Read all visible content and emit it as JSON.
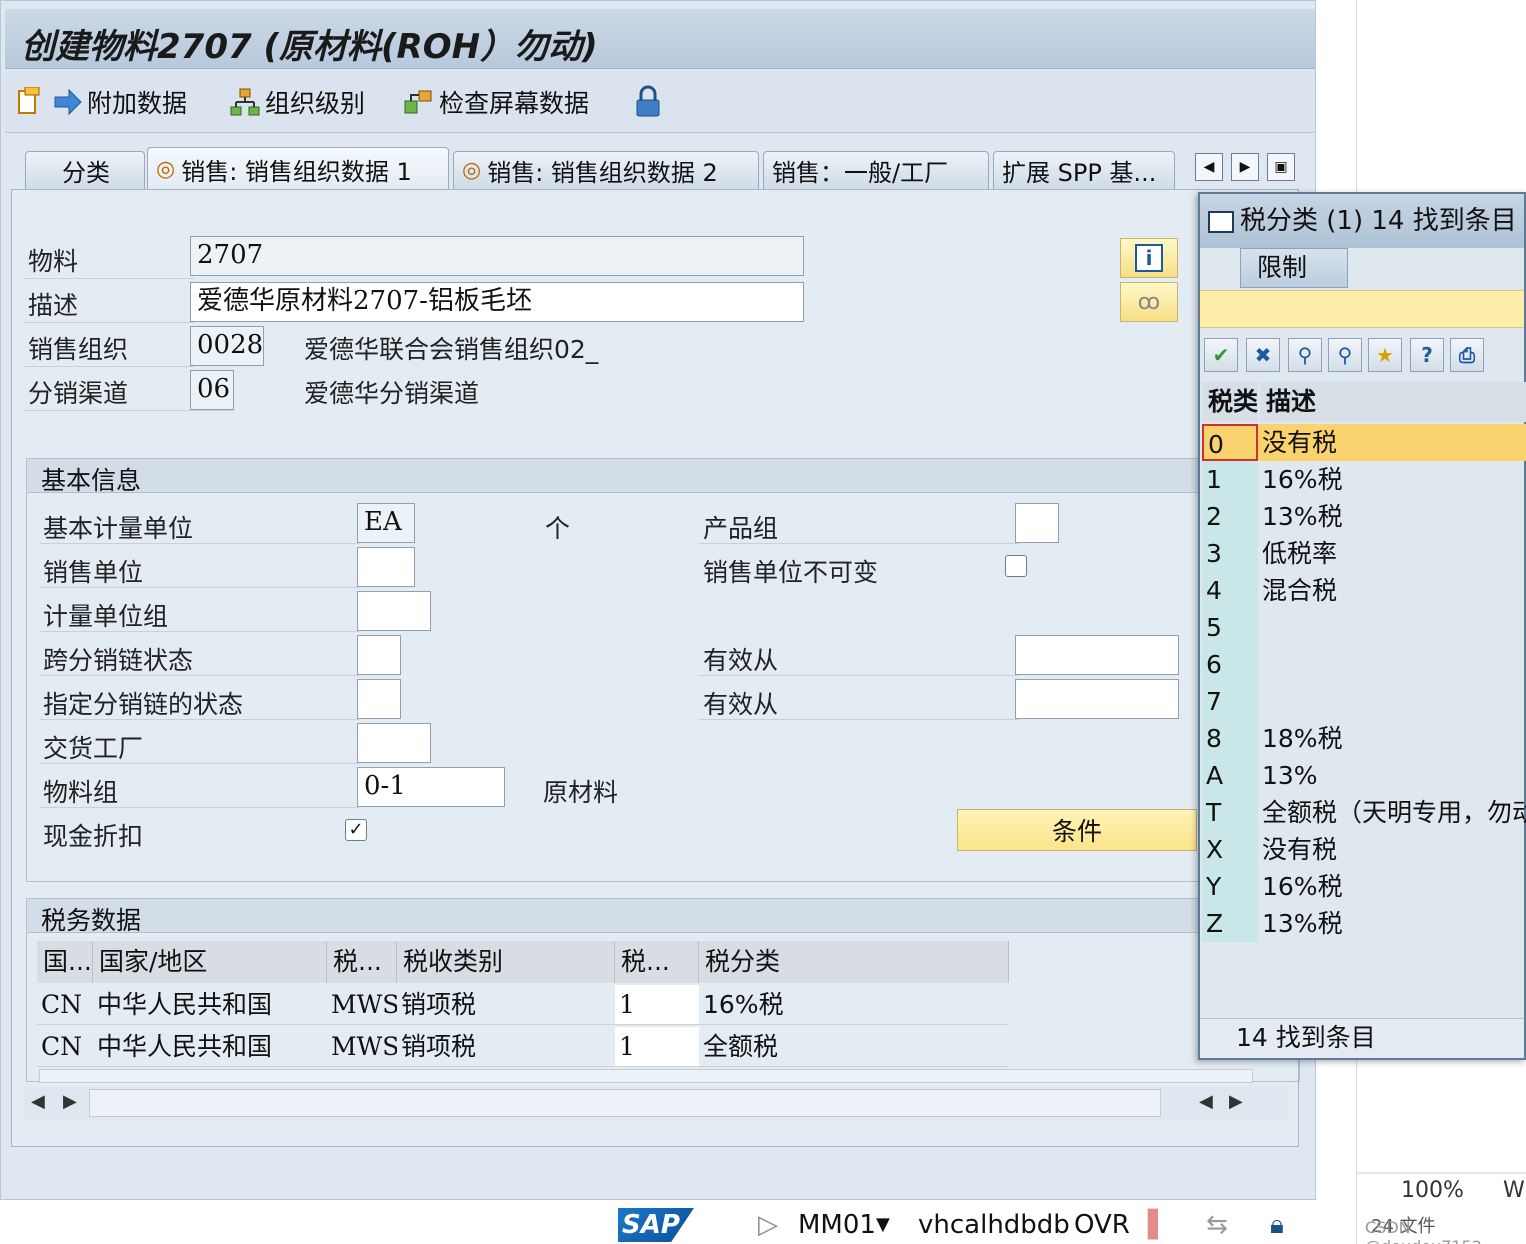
{
  "window": {
    "title": "创建物料2707 (原材料(ROH）勿动)"
  },
  "toolbar": {
    "additional_data": "附加数据",
    "org_levels": "组织级别",
    "check_screen": "检查屏幕数据"
  },
  "tabs": [
    {
      "label": "分类"
    },
    {
      "label": "销售: 销售组织数据 1"
    },
    {
      "label": "销售: 销售组织数据 2"
    },
    {
      "label": "销售：一般/工厂"
    },
    {
      "label": "扩展 SPP 基..."
    }
  ],
  "header": {
    "material_label": "物料",
    "material_value": "2707",
    "desc_label": "描述",
    "desc_value": "爱德华原材料2707-铝板毛坯",
    "salesorg_label": "销售组织",
    "salesorg_value": "0028",
    "salesorg_text": "爱德华联合会销售组织02_",
    "channel_label": "分销渠道",
    "channel_value": "06",
    "channel_text": "爱德华分销渠道"
  },
  "basic": {
    "title": "基本信息",
    "base_uom_label": "基本计量单位",
    "base_uom_value": "EA",
    "base_uom_text": "个",
    "sales_unit_label": "销售单位",
    "uom_group_label": "计量单位组",
    "xdchain_label": "跨分销链状态",
    "dchain_label": "指定分销链的状态",
    "plant_label": "交货工厂",
    "matgroup_label": "物料组",
    "matgroup_value": "0-1",
    "matgroup_text": "原材料",
    "cash_discount_label": "现金折扣",
    "prodgroup_label": "产品组",
    "sales_unit_fixed_label": "销售单位不可变",
    "valid_from_label": "有效从",
    "valid_from2_label": "有效从",
    "conditions_button": "条件"
  },
  "tax": {
    "title": "税务数据",
    "columns": [
      "国...",
      "国家/地区",
      "税...",
      "税收类别",
      "税...",
      "税分类"
    ],
    "rows": [
      [
        "CN",
        "中华人民共和国",
        "MWST",
        "销项税",
        "1",
        "16%税"
      ],
      [
        "CN",
        "中华人民共和国",
        "MWSI",
        "销项税",
        "1",
        "全额税"
      ]
    ]
  },
  "popup": {
    "title": "税分类 (1)   14 找到条目",
    "tab": "限制",
    "col_key": "税类",
    "col_desc": "描述",
    "rows": [
      [
        "0",
        "没有税"
      ],
      [
        "1",
        "16%税"
      ],
      [
        "2",
        "13%税"
      ],
      [
        "3",
        "低税率"
      ],
      [
        "4",
        "混合税"
      ],
      [
        "5",
        ""
      ],
      [
        "6",
        ""
      ],
      [
        "7",
        ""
      ],
      [
        "8",
        "18%税"
      ],
      [
        "A",
        "13%"
      ],
      [
        "T",
        "全额税（天明专用，勿动"
      ],
      [
        "X",
        "没有税"
      ],
      [
        "Y",
        "16%税"
      ],
      [
        "Z",
        "13%税"
      ]
    ],
    "footer": "14 找到条目"
  },
  "status": {
    "sap": "SAP",
    "tcode": "MM01",
    "server": "vhcalhdbdb",
    "mode": "OVR"
  },
  "rightpane": {
    "zoom": "100%",
    "letter": "W",
    "files": "24 文件",
    "watermark": "CSDN @doudou7152"
  },
  "colors": {
    "title_bg": "#b7c9dc",
    "highlight": "#fbd36e",
    "key_col": "#c9e6e8",
    "button_yellow": "#fbe48a"
  }
}
